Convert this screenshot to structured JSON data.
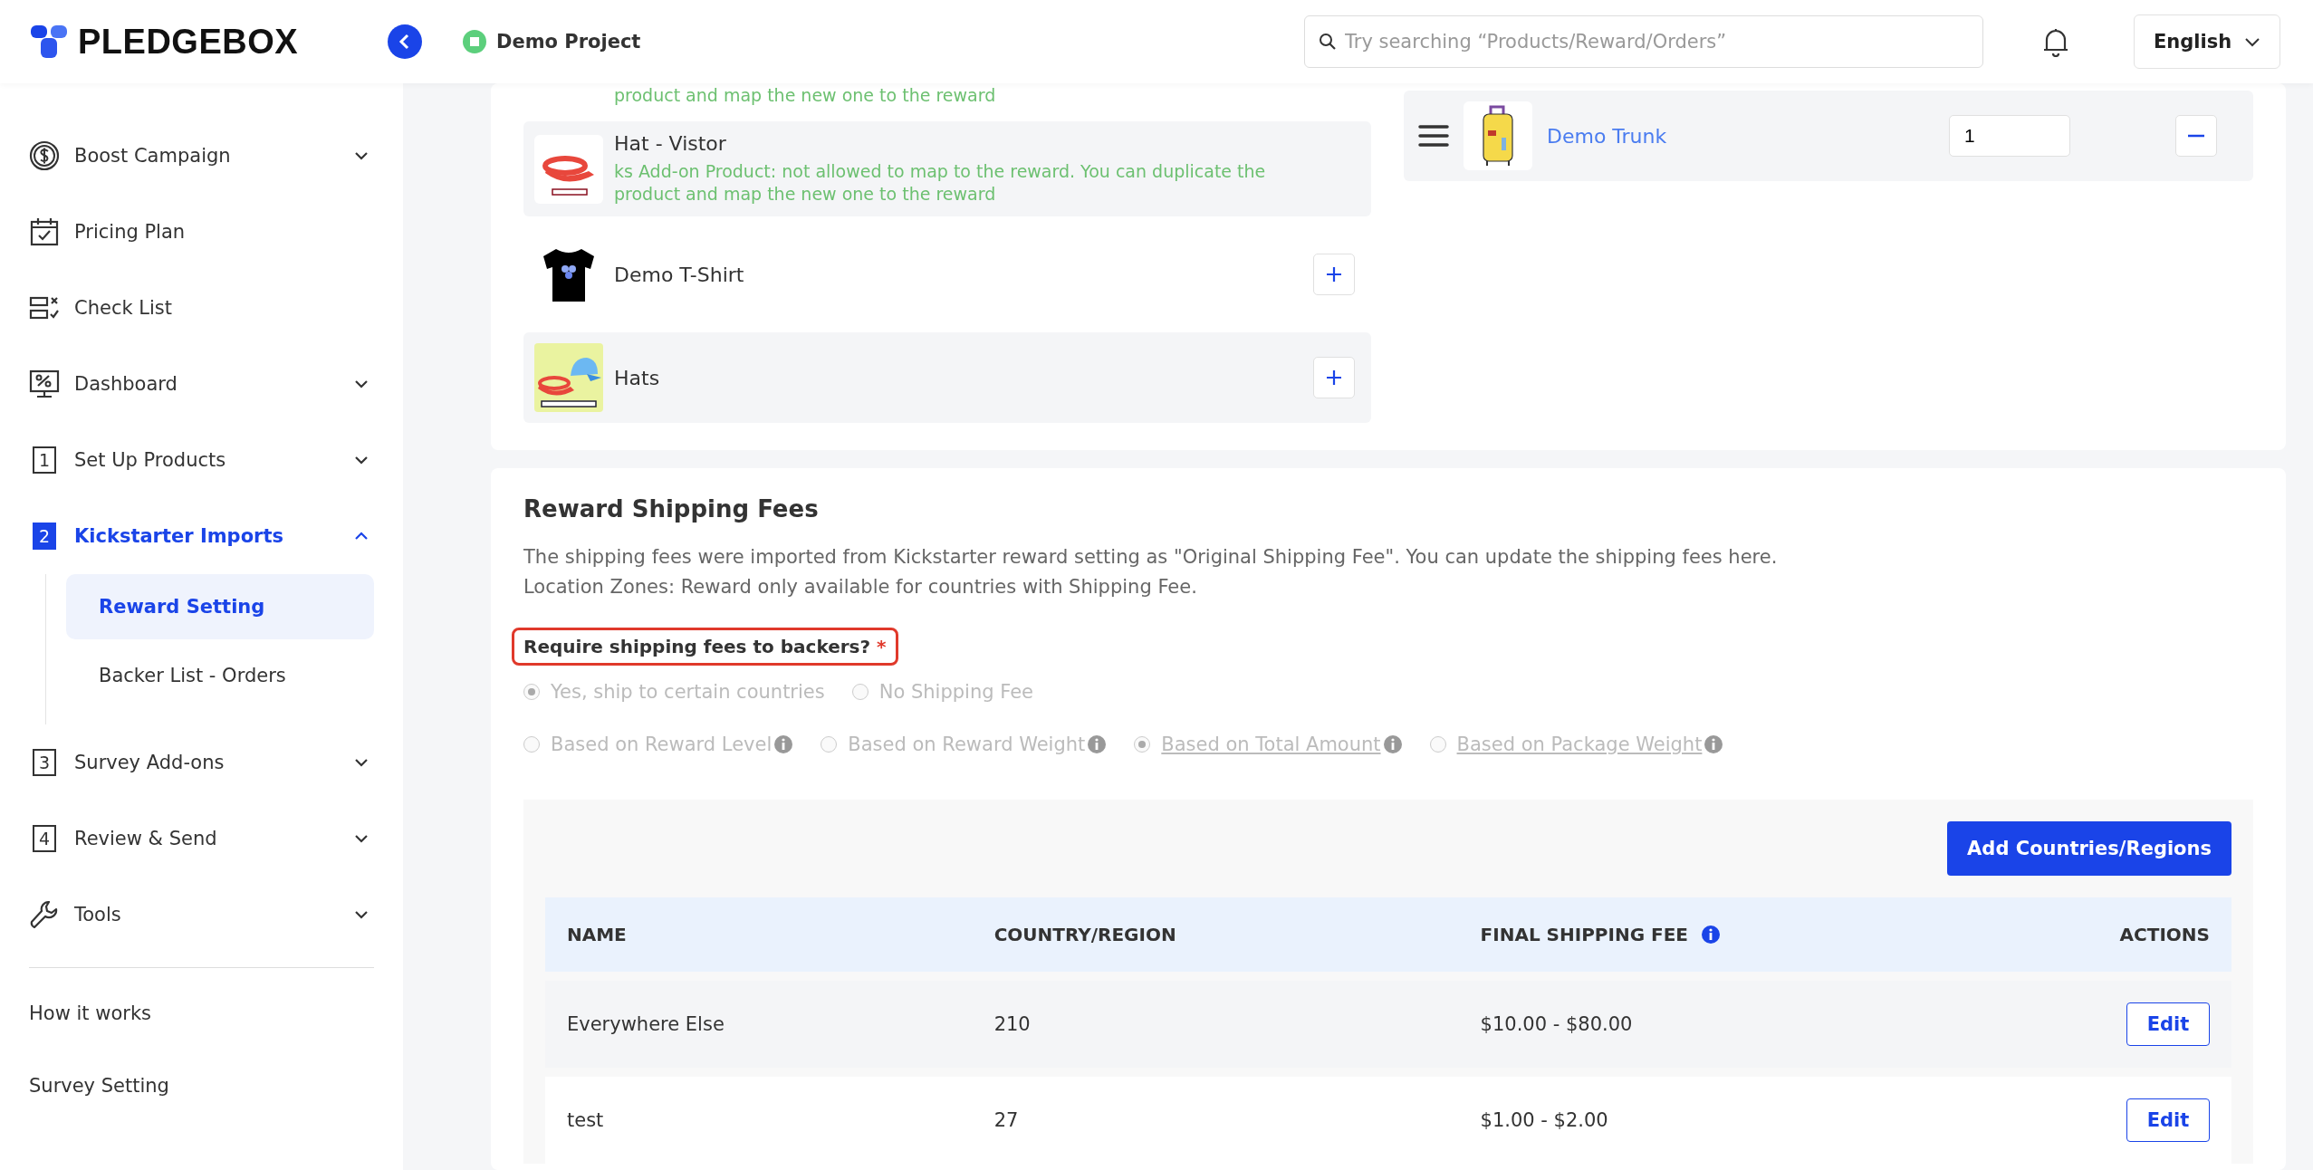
{
  "header": {
    "logo": "PLEDGEBOX",
    "project": "Demo Project",
    "search": {
      "placeholder": "Try searching “Products/Reward/Orders”"
    },
    "language": "English"
  },
  "sidebar": {
    "items": [
      {
        "label": "Boost Campaign",
        "expandable": true,
        "expanded": false,
        "selected": false
      },
      {
        "label": "Pricing Plan",
        "expandable": false,
        "selected": false
      },
      {
        "label": "Check List",
        "expandable": false,
        "selected": false
      },
      {
        "label": "Dashboard",
        "expandable": true,
        "expanded": false,
        "selected": false
      },
      {
        "label": "Set Up Products",
        "number": "1",
        "expandable": true,
        "expanded": false,
        "selected": false
      },
      {
        "label": "Kickstarter Imports",
        "number": "2",
        "expandable": true,
        "expanded": true,
        "selected": true,
        "children": [
          {
            "label": "Reward Setting",
            "selected": true
          },
          {
            "label": "Backer List - Orders",
            "selected": false
          }
        ]
      },
      {
        "label": "Survey Add-ons",
        "number": "3",
        "expandable": true,
        "expanded": false,
        "selected": false
      },
      {
        "label": "Review & Send",
        "number": "4",
        "expandable": true,
        "expanded": false,
        "selected": false
      },
      {
        "label": "Tools",
        "expandable": true,
        "expanded": false,
        "selected": false
      }
    ],
    "links": [
      "How it works",
      "Survey Setting"
    ]
  },
  "products": {
    "cut_note": "product and map the new one to the reward",
    "items": [
      {
        "name": "Hat - Vistor",
        "note": "ks Add-on Product: not allowed to map to the reward. You can duplicate the product and map the new one to the reward"
      },
      {
        "name": "Demo T-Shirt"
      },
      {
        "name": "Hats"
      }
    ]
  },
  "mapped": [
    {
      "name": "Demo Trunk",
      "quantity": "1"
    }
  ],
  "shipping": {
    "title": "Reward Shipping Fees",
    "description": [
      "The shipping fees were imported from Kickstarter reward setting as \"Original Shipping Fee\". You can update the shipping fees here.",
      "Location Zones: Reward only available for countries with Shipping Fee."
    ],
    "question": "Require shipping fees to backers?",
    "required": "*",
    "highlighted": true,
    "options": [
      {
        "label": "Yes, ship to certain countries",
        "selected": true,
        "disabled": true
      },
      {
        "label": "No Shipping Fee",
        "selected": false,
        "disabled": true
      }
    ],
    "methods": [
      {
        "label": "Based on Reward Level",
        "selected": false,
        "disabled": true,
        "underlined": false
      },
      {
        "label": "Based on Reward Weight",
        "selected": false,
        "disabled": true,
        "underlined": false
      },
      {
        "label": "Based on Total Amount",
        "selected": true,
        "disabled": true,
        "underlined": true
      },
      {
        "label": "Based on Package Weight",
        "selected": false,
        "disabled": true,
        "underlined": true
      }
    ],
    "add_button": "Add Countries/Regions",
    "table": {
      "columns": [
        {
          "label": "NAME",
          "info": false
        },
        {
          "label": "COUNTRY/REGION",
          "info": false
        },
        {
          "label": "FINAL SHIPPING FEE",
          "info": true
        },
        {
          "label": "ACTIONS",
          "info": false
        }
      ],
      "rows": [
        {
          "name": "Everywhere Else",
          "countries": "210",
          "fee": "$10.00 - $80.00",
          "action": "Edit"
        },
        {
          "name": "test",
          "countries": "27",
          "fee": "$1.00 - $2.00",
          "action": "Edit"
        }
      ]
    }
  }
}
